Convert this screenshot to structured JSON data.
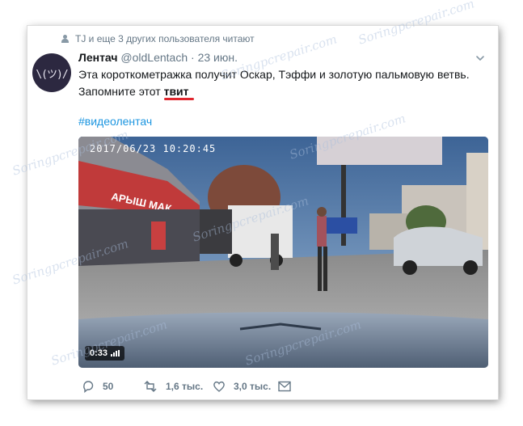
{
  "context": {
    "text_prefix": "TJ и еще 3 других пользователя читают"
  },
  "avatar_text": "\\(ツ)/",
  "tweet": {
    "author_name": "Лентач",
    "handle": "@oldLentach",
    "separator": "·",
    "date": "23 июн.",
    "text_line1": "Эта короткометражка получит Оскар, Тэффи и золотую пальмовую ветвь.",
    "text_line2_prefix": "Запомните этот ",
    "text_line2_highlight": "твит",
    "hashtag": "#видеолентач"
  },
  "media": {
    "timestamp": "2017/06/23 10:20:45",
    "duration": "0:33",
    "sign_text": "АРЫШ МАК"
  },
  "actions": {
    "reply_count": "50",
    "retweet_count": "1,6 тыс.",
    "like_count": "3,0 тыс."
  },
  "watermark": "Soringpcrepair.com",
  "colors": {
    "link": "#1b95e0",
    "underline": "#e0262e",
    "muted": "#657786"
  }
}
